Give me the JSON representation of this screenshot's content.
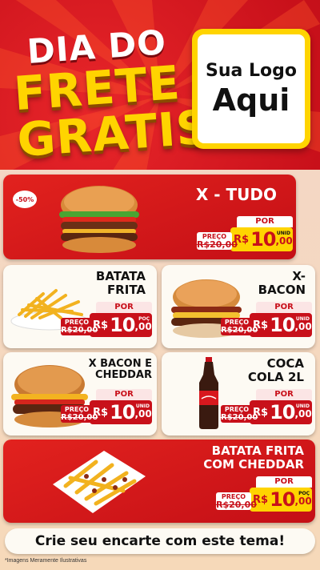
{
  "header": {
    "line1": "DIA DO",
    "line2": "FRETE",
    "line3": "GRATIS"
  },
  "logo": {
    "line1": "Sua Logo",
    "line2": "Aqui"
  },
  "products": [
    {
      "name": "X - TUDO",
      "old_label": "PREÇO",
      "old_price": "R$20,00",
      "por": "POR",
      "currency": "R$",
      "price_int": "10",
      "price_cents": ",00",
      "unit": "UNID",
      "badge": "-50%"
    },
    {
      "name_l1": "BATATA",
      "name_l2": "FRITA",
      "old_label": "PREÇO",
      "old_price": "R$20,00",
      "por": "POR",
      "currency": "R$",
      "price_int": "10",
      "price_cents": ",00",
      "unit": "POÇ"
    },
    {
      "name_l1": "X-",
      "name_l2": "BACON",
      "old_label": "PREÇO",
      "old_price": "R$20,00",
      "por": "POR",
      "currency": "R$",
      "price_int": "10",
      "price_cents": ",00",
      "unit": "UNID"
    },
    {
      "name_l1": "X BACON E",
      "name_l2": "CHEDDAR",
      "old_label": "PREÇO",
      "old_price": "R$20,00",
      "por": "POR",
      "currency": "R$",
      "price_int": "10",
      "price_cents": ",00",
      "unit": "UNID"
    },
    {
      "name_l1": "COCA",
      "name_l2": "COLA 2L",
      "old_label": "PREÇO",
      "old_price": "R$20,00",
      "por": "POR",
      "currency": "R$",
      "price_int": "10",
      "price_cents": ",00",
      "unit": "UNID"
    },
    {
      "name_l1": "BATATA FRITA",
      "name_l2": "COM CHEDDAR",
      "old_label": "PREÇO",
      "old_price": "R$20,00",
      "por": "POR",
      "currency": "R$",
      "price_int": "10",
      "price_cents": ",00",
      "unit": "POÇ"
    }
  ],
  "footer": {
    "cta": "Crie seu encarte com este tema!",
    "disclaimer": "*Imagens Meramente Ilustrativas"
  },
  "colors": {
    "red": "#c8101a",
    "yellow": "#ffd400",
    "cream": "#fdfaf3"
  }
}
